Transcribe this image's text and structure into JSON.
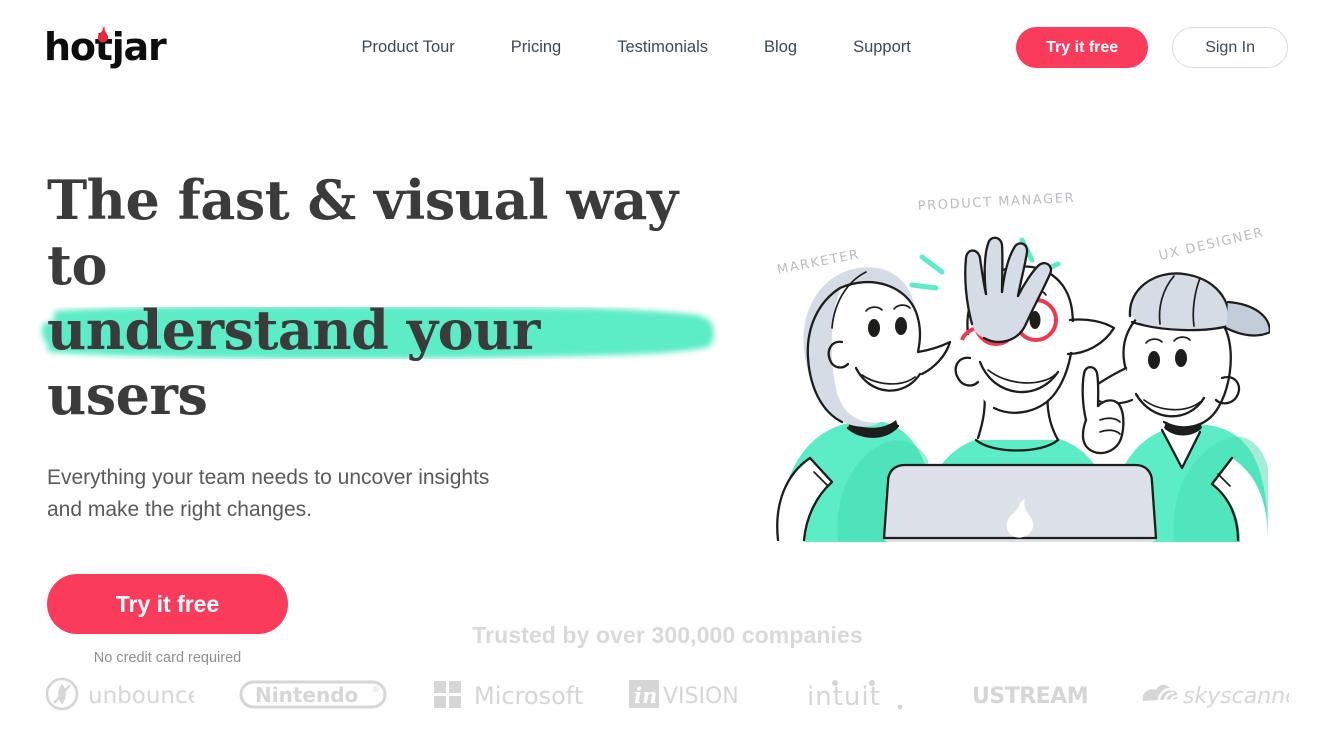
{
  "brand": {
    "logo_text_part1": "hot",
    "logo_text_part2": "jar",
    "flame_color": "#e8283c",
    "accent_pink": "#fb3b5c",
    "accent_mint": "#5cecc6",
    "text_dark": "#3b3b3b"
  },
  "nav": {
    "items": [
      {
        "label": "Product Tour"
      },
      {
        "label": "Pricing"
      },
      {
        "label": "Testimonials"
      },
      {
        "label": "Blog"
      },
      {
        "label": "Support"
      }
    ],
    "try_free_label": "Try it free",
    "sign_in_label": "Sign In"
  },
  "hero": {
    "headline_line1": "The fast & visual way",
    "headline_line2_prefix": "to ",
    "headline_line2_highlight": "understand your users",
    "subhead_line1": "Everything your team needs to uncover insights",
    "subhead_line2": "and make the right changes.",
    "cta_label": "Try it free",
    "cta_note": "No credit card required",
    "illustration": {
      "label_left": "MARKETER",
      "label_center": "PRODUCT  MANAGER",
      "label_right": "UX DESIGNER"
    }
  },
  "trust": {
    "title": "Trusted by over 300,000 companies",
    "logos": [
      {
        "name": "unbounce",
        "label": "unbounce"
      },
      {
        "name": "nintendo",
        "label": "Nintendo"
      },
      {
        "name": "microsoft",
        "label": "Microsoft"
      },
      {
        "name": "invision",
        "label": "VISION",
        "mark": "in"
      },
      {
        "name": "intuit",
        "label": "intuit"
      },
      {
        "name": "ustream",
        "label": "USTREAM"
      },
      {
        "name": "skyscanner",
        "label": "skyscanner"
      }
    ]
  }
}
